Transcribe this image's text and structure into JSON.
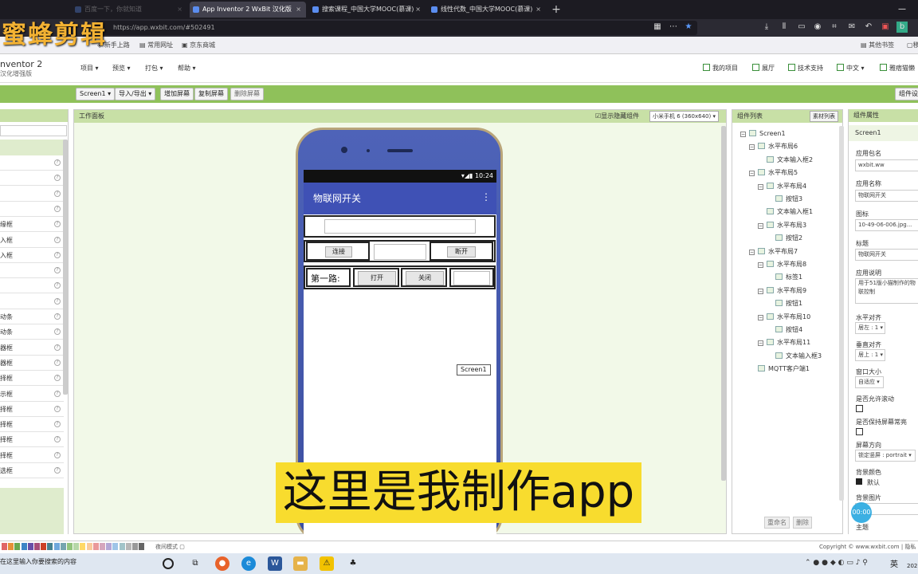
{
  "browser": {
    "tabs": [
      {
        "label": "百度一下，你就知道",
        "active": false
      },
      {
        "label": "App Inventor 2 WxBit 汉化版",
        "active": true
      },
      {
        "label": "搜索课程_中国大学MOOC(慕课)",
        "active": false
      },
      {
        "label": "线性代数_中国大学MOOC(慕课)",
        "active": false
      }
    ],
    "new_tab": "+",
    "url": "https://app.wxbit.com/#502491",
    "bookmarks": [
      "新手上路",
      "常用网址",
      "京东商城"
    ],
    "other_bookmarks": "其他书签",
    "mobile_bookmarks": "移"
  },
  "watermark": "蜜蜂剪辑",
  "app": {
    "logo_title": "nventor 2",
    "logo_sub": "汉化增强版",
    "menus": [
      "项目 ▾",
      "预览 ▾",
      "打包 ▾",
      "帮助 ▾"
    ],
    "right_menus": [
      "我的项目",
      "展厅",
      "技术支持",
      "中文 ▾",
      "雅痞猫懒"
    ],
    "toolbar": {
      "screen_select": "Screen1 ▾",
      "import_export": "导入/导出 ▾",
      "add_screen": "增加屏幕",
      "copy_screen": "复制屏幕",
      "delete_screen": "删除屏幕",
      "component_settings": "组件设"
    }
  },
  "palette": {
    "items": [
      "",
      "",
      "",
      "",
      "缘框",
      "入框",
      "入框",
      "",
      "",
      "",
      "动条",
      "动条",
      "器框",
      "器框",
      "择框",
      "示框",
      "择框",
      "择框",
      "择框",
      "择框",
      "选框"
    ]
  },
  "viewer": {
    "title": "工作面板",
    "show_hidden": "显示隐藏组件",
    "device": "小米手机 6 (360x640) ▾",
    "phone": {
      "time": "10:24",
      "app_title": "物联网开关",
      "kebab": "⋮",
      "btn_connect": "连接",
      "btn_disconnect": "断开",
      "label_route1": "第一路:",
      "btn_open": "打开",
      "btn_close": "关闭"
    },
    "tooltip": "Screen1"
  },
  "components": {
    "title": "组件列表",
    "assets_button": "素材列表",
    "rename_button": "重命名",
    "delete_button": "删除",
    "tree": [
      {
        "label": "Screen1",
        "level": 0,
        "toggle": "⊟"
      },
      {
        "label": "水平布局6",
        "level": 1,
        "toggle": "⊟"
      },
      {
        "label": "文本输入框2",
        "level": 2,
        "toggle": ""
      },
      {
        "label": "水平布局5",
        "level": 1,
        "toggle": "⊟"
      },
      {
        "label": "水平布局4",
        "level": 2,
        "toggle": "⊟"
      },
      {
        "label": "按钮3",
        "level": 3,
        "toggle": ""
      },
      {
        "label": "文本输入框1",
        "level": 2,
        "toggle": ""
      },
      {
        "label": "水平布局3",
        "level": 2,
        "toggle": "⊟"
      },
      {
        "label": "按钮2",
        "level": 3,
        "toggle": ""
      },
      {
        "label": "水平布局7",
        "level": 1,
        "toggle": "⊟"
      },
      {
        "label": "水平布局8",
        "level": 2,
        "toggle": "⊟"
      },
      {
        "label": "标签1",
        "level": 3,
        "toggle": ""
      },
      {
        "label": "水平布局9",
        "level": 2,
        "toggle": "⊟"
      },
      {
        "label": "按钮1",
        "level": 3,
        "toggle": ""
      },
      {
        "label": "水平布局10",
        "level": 2,
        "toggle": "⊟"
      },
      {
        "label": "按钮4",
        "level": 3,
        "toggle": ""
      },
      {
        "label": "水平布局11",
        "level": 2,
        "toggle": "⊟"
      },
      {
        "label": "文本输入框3",
        "level": 3,
        "toggle": ""
      },
      {
        "label": "MQTT客户端1",
        "level": 1,
        "toggle": ""
      }
    ]
  },
  "properties": {
    "title": "组件属性",
    "component": "Screen1",
    "app_package_label": "应用包名",
    "app_package": "wxbit.ww",
    "app_name_label": "应用名称",
    "app_name": "物联网开关",
    "icon_label": "图标",
    "icon": "10-49-06-006.jpg...",
    "title_label": "标题",
    "title_value": "物联网开关",
    "desc_label": "应用说明",
    "desc": "用于51版小猫制作的物联控制",
    "halign_label": "水平对齐",
    "halign": "居左 : 1 ▾",
    "valign_label": "垂直对齐",
    "valign": "居上 : 1 ▾",
    "size_label": "窗口大小",
    "size": "自适应 ▾",
    "scroll_label": "是否允许滚动",
    "keep_on_label": "是否保持屏幕常亮",
    "orient_label": "屏幕方向",
    "orient": "锁定竖屏 : portrait ▾",
    "bgcolor_label": "背景颜色",
    "bgcolor": "默认",
    "bgimage_label": "背景图片",
    "theme_label": "主题"
  },
  "subtitle": "这里是我制作app",
  "play_badge": "00:00",
  "footer": {
    "night_mode": "夜间模式",
    "copyright": "Copyright © www.wxbit.com | 隐私"
  },
  "taskbar": {
    "search_placeholder": "在这里输入你要搜索的内容",
    "lang": "英",
    "year": "202"
  },
  "colors": {
    "toolbar_green": "#8fc15a",
    "panel_header": "#c8e0a6",
    "phone_appbar": "#3f51b5",
    "subtitle_bg": "#f8dc2e",
    "watermark": "#f3b233"
  }
}
